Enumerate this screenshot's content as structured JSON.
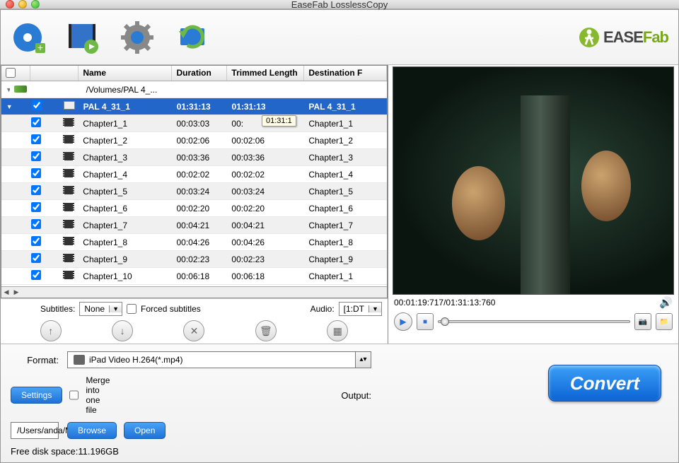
{
  "window": {
    "title": "EaseFab LosslessCopy"
  },
  "logo": {
    "prefix": "EASE",
    "suffix": "Fab"
  },
  "columns": {
    "name": "Name",
    "duration": "Duration",
    "trimmed": "Trimmed Length",
    "destination": "Destination F"
  },
  "source_row": {
    "path": "/Volumes/PAL 4_..."
  },
  "selected_row": {
    "name": "PAL 4_31_1",
    "duration": "01:31:13",
    "trimmed": "01:31:13",
    "destination": "PAL 4_31_1"
  },
  "tooltip": "01:31:1",
  "chapters": [
    {
      "name": "Chapter1_1",
      "duration": "00:03:03",
      "trimmed": "00:",
      "destination": "Chapter1_1"
    },
    {
      "name": "Chapter1_2",
      "duration": "00:02:06",
      "trimmed": "00:02:06",
      "destination": "Chapter1_2"
    },
    {
      "name": "Chapter1_3",
      "duration": "00:03:36",
      "trimmed": "00:03:36",
      "destination": "Chapter1_3"
    },
    {
      "name": "Chapter1_4",
      "duration": "00:02:02",
      "trimmed": "00:02:02",
      "destination": "Chapter1_4"
    },
    {
      "name": "Chapter1_5",
      "duration": "00:03:24",
      "trimmed": "00:03:24",
      "destination": "Chapter1_5"
    },
    {
      "name": "Chapter1_6",
      "duration": "00:02:20",
      "trimmed": "00:02:20",
      "destination": "Chapter1_6"
    },
    {
      "name": "Chapter1_7",
      "duration": "00:04:21",
      "trimmed": "00:04:21",
      "destination": "Chapter1_7"
    },
    {
      "name": "Chapter1_8",
      "duration": "00:04:26",
      "trimmed": "00:04:26",
      "destination": "Chapter1_8"
    },
    {
      "name": "Chapter1_9",
      "duration": "00:02:23",
      "trimmed": "00:02:23",
      "destination": "Chapter1_9"
    },
    {
      "name": "Chapter1_10",
      "duration": "00:06:18",
      "trimmed": "00:06:18",
      "destination": "Chapter1_1"
    }
  ],
  "subs": {
    "label": "Subtitles:",
    "value": "None",
    "forced_label": "Forced subtitles",
    "audio_label": "Audio:",
    "audio_value": "[1:DT"
  },
  "preview": {
    "time": "00:01:19:717/01:31:13:760"
  },
  "bottom": {
    "format_label": "Format:",
    "format_value": "iPad Video H.264(*.mp4)",
    "settings": "Settings",
    "merge_label": "Merge into one file",
    "output_label": "Output:",
    "output_value": "/Users/anda/Movies",
    "browse": "Browse",
    "open": "Open",
    "convert": "Convert",
    "freespace": "Free disk space:11.196GB"
  }
}
